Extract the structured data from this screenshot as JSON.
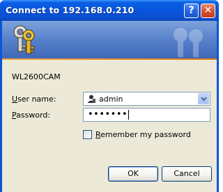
{
  "dialog": {
    "title": "Connect to 192.168.0.210",
    "server_name": "WL2600CAM"
  },
  "fields": {
    "username_label_accel": "U",
    "username_label_rest": "ser name:",
    "username_value": "admin",
    "password_label_accel": "P",
    "password_label_rest": "assword:",
    "password_value": "•••••••"
  },
  "remember": {
    "label_accel": "R",
    "label_rest": "emember my password",
    "checked": false
  },
  "buttons": {
    "ok": "OK",
    "cancel": "Cancel",
    "help": "?",
    "close": "✕"
  },
  "colors": {
    "titlebar": "#0855dd",
    "banner": "#5b84cd",
    "banner_line": "#e07c10",
    "client": "#ece9d8"
  },
  "icons": [
    "keys-icon",
    "keys-watermark-icon",
    "user-icon",
    "chevron-down-icon"
  ]
}
